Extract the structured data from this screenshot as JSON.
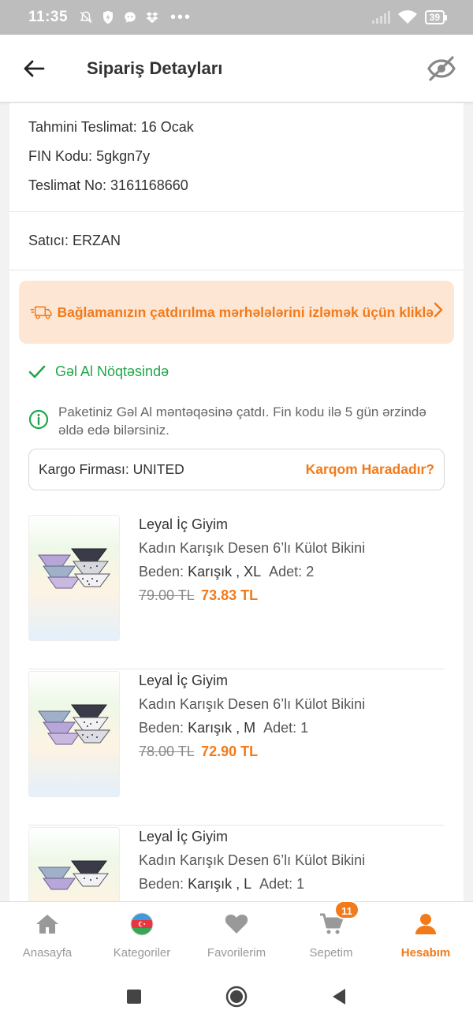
{
  "status_bar": {
    "time": "11:35",
    "battery": "39",
    "more": "•••"
  },
  "header": {
    "title": "Sipariş Detayları"
  },
  "order_info": {
    "delivery_label": "Tahmini Teslimat:",
    "delivery_value": "16 Ocak",
    "fin_label": "FIN Kodu:",
    "fin_value": "5gkgn7y",
    "delivery_no_label": "Teslimat No:",
    "delivery_no_value": "3161168660",
    "seller_label": "Satıcı:",
    "seller_value": "ERZAN"
  },
  "tracking_banner": {
    "text": "Bağlamanızın çatdırılma mərhələlərini izləmək üçün kliklə"
  },
  "shipment_status": {
    "text": "Gəl Al Nöqtəsində",
    "note": "Paketiniz Gəl Al məntəqəsinə çatdı. Fin kodu ilə 5 gün ərzində əldə edə bilərsiniz."
  },
  "cargo": {
    "label": "Kargo Firması:",
    "value": "UNITED",
    "link": "Karqom Haradadır?"
  },
  "products": [
    {
      "brand": "Leyal İç Giyim",
      "name": "Kadın Karışık Desen 6’lı Külot Bikini",
      "size_label": "Beden:",
      "size_value": "Karışık , XL",
      "qty_label": "Adet:",
      "qty_value": "2",
      "old_price": "79.00 TL",
      "new_price": "73.83 TL"
    },
    {
      "brand": "Leyal İç Giyim",
      "name": "Kadın Karışık Desen 6’lı Külot Bikini",
      "size_label": "Beden:",
      "size_value": "Karışık , M",
      "qty_label": "Adet:",
      "qty_value": "1",
      "old_price": "78.00 TL",
      "new_price": "72.90 TL"
    },
    {
      "brand": "Leyal İç Giyim",
      "name": "Kadın Karışık Desen 6’lı Külot Bikini",
      "size_label": "Beden:",
      "size_value": "Karışık , L",
      "qty_label": "Adet:",
      "qty_value": "1",
      "old_price": "",
      "new_price": ""
    }
  ],
  "bottom_nav": {
    "items": [
      {
        "label": "Anasayfa",
        "icon": "home-icon"
      },
      {
        "label": "Kategoriler",
        "icon": "azerbaijan-flag-icon"
      },
      {
        "label": "Favorilerim",
        "icon": "heart-icon"
      },
      {
        "label": "Sepetim",
        "icon": "cart-icon"
      },
      {
        "label": "Hesabım",
        "icon": "user-icon"
      }
    ],
    "cart_badge": "11"
  },
  "colors": {
    "accent": "#f27a1a",
    "success": "#1fa64a",
    "banner_bg": "#fde6d4"
  }
}
